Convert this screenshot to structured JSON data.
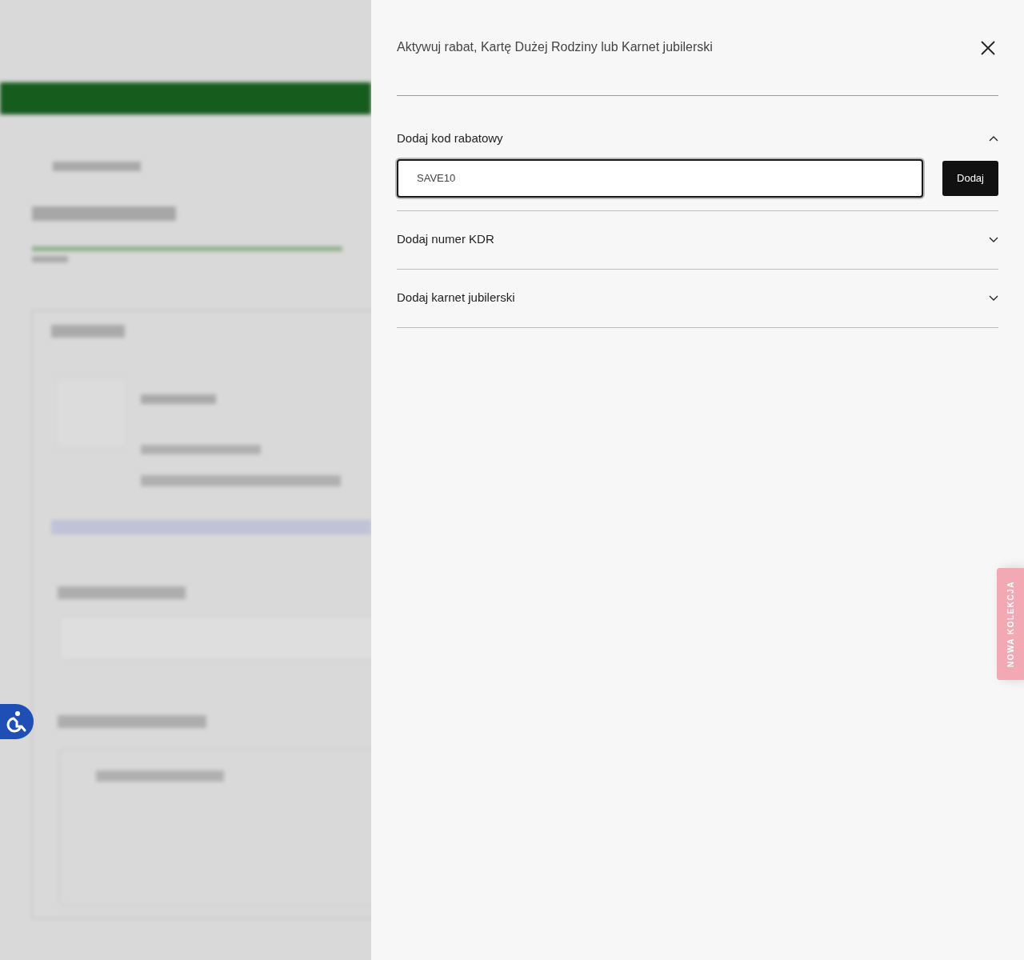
{
  "dialog": {
    "title": "Aktywuj rabat, Kartę Dużej Rodziny lub Karnet jubilerski",
    "sections": [
      {
        "title": "Dodaj kod rabatowy",
        "expanded": true,
        "input": {
          "value": "SAVE10"
        },
        "button": "Dodaj"
      },
      {
        "title": "Dodaj numer KDR",
        "expanded": false
      },
      {
        "title": "Dodaj karnet jubilerski",
        "expanded": false
      }
    ]
  },
  "side_tab": {
    "label": "NOWA KOLEKCJA"
  }
}
